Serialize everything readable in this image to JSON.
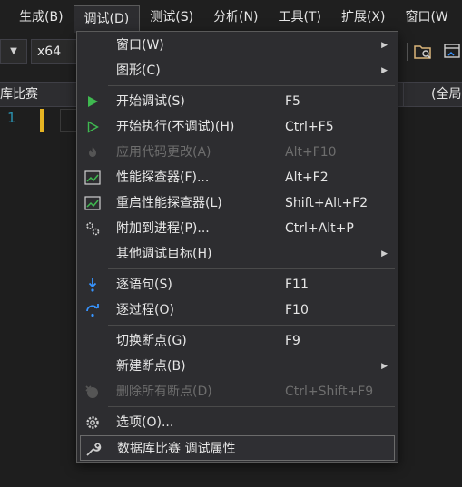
{
  "menubar": {
    "items": [
      {
        "label": "生成(B)"
      },
      {
        "label": "调试(D)"
      },
      {
        "label": "测试(S)"
      },
      {
        "label": "分析(N)"
      },
      {
        "label": "工具(T)"
      },
      {
        "label": "扩展(X)"
      },
      {
        "label": "窗口(W"
      }
    ]
  },
  "toolbar": {
    "platform": "x64"
  },
  "tabs": {
    "file_tab": "库比赛",
    "scope": "(全局"
  },
  "editor": {
    "line_number": "1"
  },
  "debug_menu": {
    "items": [
      {
        "label": "窗口(W)",
        "shortcut": ""
      },
      {
        "label": "图形(C)",
        "shortcut": ""
      },
      {
        "label": "开始调试(S)",
        "shortcut": "F5"
      },
      {
        "label": "开始执行(不调试)(H)",
        "shortcut": "Ctrl+F5"
      },
      {
        "label": "应用代码更改(A)",
        "shortcut": "Alt+F10"
      },
      {
        "label": "性能探查器(F)...",
        "shortcut": "Alt+F2"
      },
      {
        "label": "重启性能探查器(L)",
        "shortcut": "Shift+Alt+F2"
      },
      {
        "label": "附加到进程(P)...",
        "shortcut": "Ctrl+Alt+P"
      },
      {
        "label": "其他调试目标(H)",
        "shortcut": ""
      },
      {
        "label": "逐语句(S)",
        "shortcut": "F11"
      },
      {
        "label": "逐过程(O)",
        "shortcut": "F10"
      },
      {
        "label": "切换断点(G)",
        "shortcut": "F9"
      },
      {
        "label": "新建断点(B)",
        "shortcut": ""
      },
      {
        "label": "删除所有断点(D)",
        "shortcut": "Ctrl+Shift+F9"
      },
      {
        "label": "选项(O)...",
        "shortcut": ""
      },
      {
        "label": "数据库比赛 调试属性",
        "shortcut": ""
      }
    ]
  },
  "colors": {
    "play_green": "#3fb950",
    "step_blue": "#3794ff",
    "change_bar": "#e6b422"
  }
}
